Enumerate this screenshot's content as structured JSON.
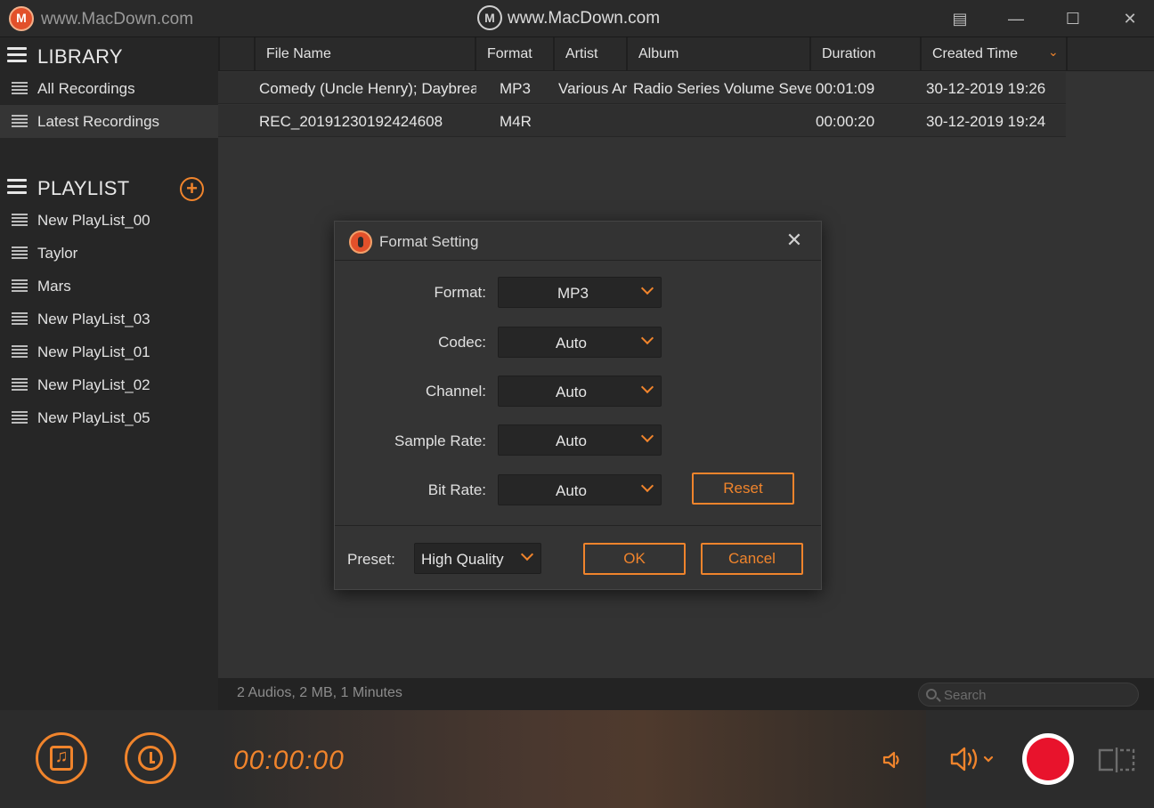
{
  "window": {
    "title": "www.MacDown.com",
    "watermark_text": "www.MacDown.com",
    "controls": {
      "minimize": "—",
      "maximize": "☐",
      "close": "✕"
    }
  },
  "sidebar": {
    "library_title": "LIBRARY",
    "library_items": [
      {
        "label": "All Recordings",
        "active": false
      },
      {
        "label": "Latest Recordings",
        "active": true
      }
    ],
    "playlist_title": "PLAYLIST",
    "add_label": "+",
    "playlists": [
      {
        "label": "New PlayList_00"
      },
      {
        "label": "Taylor"
      },
      {
        "label": "Mars"
      },
      {
        "label": "New PlayList_03"
      },
      {
        "label": "New PlayList_01"
      },
      {
        "label": "New PlayList_02"
      },
      {
        "label": "New PlayList_05"
      }
    ]
  },
  "table": {
    "columns": [
      "File Name",
      "Format",
      "Artist",
      "Album",
      "Duration",
      "Created Time"
    ],
    "sort_indicator": "⌄",
    "rows": [
      {
        "file_name": "Comedy (Uncle Henry); Daybrea",
        "format": "MP3",
        "artist": "Various Ar",
        "album": "Radio Series Volume Sever",
        "duration": "00:01:09",
        "created": "30-12-2019 19:26"
      },
      {
        "file_name": "REC_20191230192424608",
        "format": "M4R",
        "artist": "",
        "album": "",
        "duration": "00:00:20",
        "created": "30-12-2019 19:24"
      }
    ]
  },
  "status": {
    "summary": "2 Audios, 2 MB, 1 Minutes",
    "search_placeholder": "Search"
  },
  "player": {
    "timer": "00:00:00"
  },
  "dialog": {
    "title": "Format Setting",
    "close_label": "✕",
    "fields": {
      "format": {
        "label": "Format:",
        "value": "MP3"
      },
      "codec": {
        "label": "Codec:",
        "value": "Auto"
      },
      "channel": {
        "label": "Channel:",
        "value": "Auto"
      },
      "sample_rate": {
        "label": "Sample Rate:",
        "value": "Auto"
      },
      "bit_rate": {
        "label": "Bit Rate:",
        "value": "Auto"
      }
    },
    "reset_label": "Reset",
    "preset_label": "Preset:",
    "preset_value": "High Quality",
    "ok_label": "OK",
    "cancel_label": "Cancel"
  },
  "colors": {
    "accent": "#f0842c",
    "record": "#e8132c",
    "background": "#2d2d2d"
  }
}
